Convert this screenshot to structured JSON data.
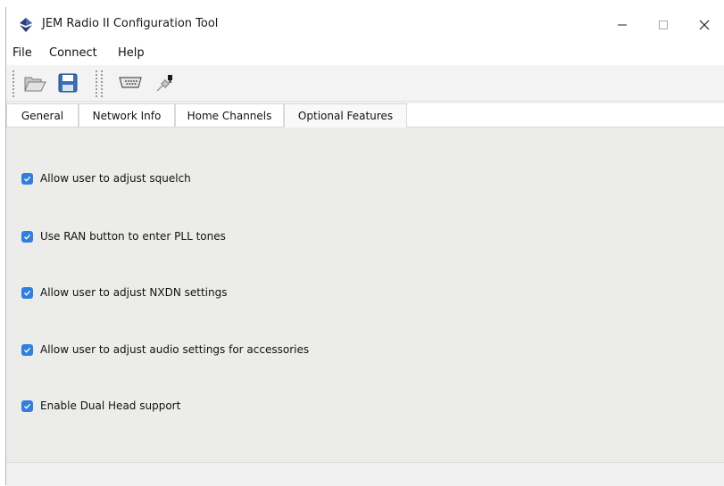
{
  "window": {
    "title": "JEM Radio II Configuration Tool",
    "app_icon": "app-diamond-icon",
    "controls": {
      "minimize": "minimize-icon",
      "maximize": "maximize-icon",
      "close": "close-icon"
    }
  },
  "menubar": {
    "items": [
      {
        "label": "File"
      },
      {
        "label": "Connect"
      },
      {
        "label": "Help"
      }
    ]
  },
  "toolbar": {
    "buttons": [
      {
        "icon": "open-folder-icon"
      },
      {
        "icon": "save-disk-icon"
      },
      {
        "icon": "serial-port-icon"
      },
      {
        "icon": "connect-plug-icon"
      }
    ]
  },
  "tabs": [
    {
      "label": "General",
      "selected": false
    },
    {
      "label": "Network Info",
      "selected": false
    },
    {
      "label": "Home Channels",
      "selected": false
    },
    {
      "label": "Optional Features",
      "selected": true
    }
  ],
  "options": [
    {
      "label": "Allow user to adjust squelch",
      "checked": true
    },
    {
      "label": "Use RAN button to enter PLL tones",
      "checked": true
    },
    {
      "label": "Allow user to adjust NXDN settings",
      "checked": true
    },
    {
      "label": "Allow user to adjust audio settings for accessories",
      "checked": true
    },
    {
      "label": "Enable Dual Head support",
      "checked": true
    }
  ],
  "colors": {
    "checkbox_checked": "#2f7fe0",
    "panel_bg": "#ececea"
  }
}
